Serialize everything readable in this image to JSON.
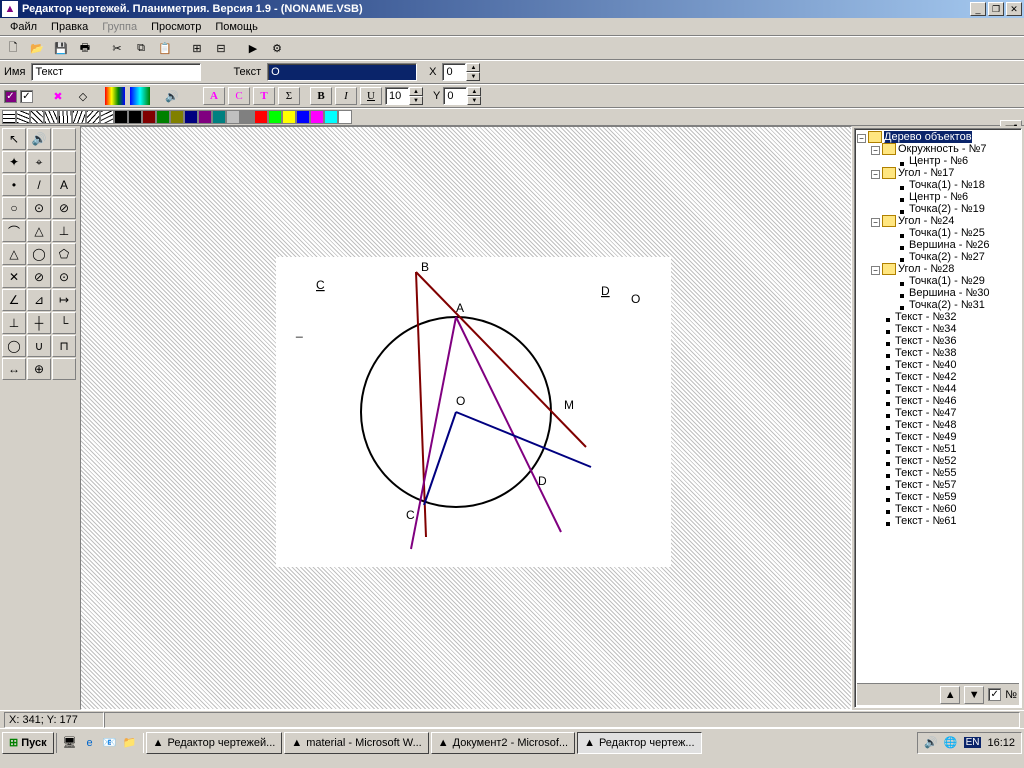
{
  "window": {
    "title": "Редактор чертежей. Планиметрия. Версия 1.9 - (NONAME.VSB)"
  },
  "menu": {
    "file": "Файл",
    "edit": "Правка",
    "group": "Группа",
    "view": "Просмотр",
    "help": "Помощь"
  },
  "props": {
    "name_label": "Имя",
    "name_value": "Текст",
    "text_label": "Текст",
    "text_value": "O",
    "x_label": "X",
    "x_value": "0",
    "y_label": "Y",
    "y_value": "0",
    "fontsize": "10",
    "btn_A": "A",
    "btn_C": "C",
    "btn_T": "T",
    "btn_sigma": "Σ",
    "btn_B": "B",
    "btn_I": "I",
    "btn_U": "U"
  },
  "palette": [
    "#000000",
    "#800000",
    "#008000",
    "#808000",
    "#000080",
    "#800080",
    "#008080",
    "#c0c0c0",
    "#808080",
    "#ff0000",
    "#00ff00",
    "#ffff00",
    "#0000ff",
    "#ff00ff",
    "#00ffff",
    "#ffffff"
  ],
  "tree": {
    "root": "Дерево объектов",
    "nodes": [
      {
        "type": "folder",
        "label": "Окружность - №7",
        "children": [
          {
            "type": "leaf",
            "label": "Центр - №6"
          }
        ]
      },
      {
        "type": "folder",
        "label": "Угол - №17",
        "children": [
          {
            "type": "leaf",
            "label": "Точка(1) - №18"
          },
          {
            "type": "leaf",
            "label": "Центр - №6"
          },
          {
            "type": "leaf",
            "label": "Точка(2) - №19"
          }
        ]
      },
      {
        "type": "folder",
        "label": "Угол - №24",
        "children": [
          {
            "type": "leaf",
            "label": "Точка(1) - №25"
          },
          {
            "type": "leaf",
            "label": "Вершина - №26"
          },
          {
            "type": "leaf",
            "label": "Точка(2) - №27"
          }
        ]
      },
      {
        "type": "folder",
        "label": "Угол - №28",
        "children": [
          {
            "type": "leaf",
            "label": "Точка(1) - №29"
          },
          {
            "type": "leaf",
            "label": "Вершина - №30"
          },
          {
            "type": "leaf",
            "label": "Точка(2) - №31"
          }
        ]
      },
      {
        "type": "leaf",
        "label": "Текст - №32"
      },
      {
        "type": "leaf",
        "label": "Текст - №34"
      },
      {
        "type": "leaf",
        "label": "Текст - №36"
      },
      {
        "type": "leaf",
        "label": "Текст - №38"
      },
      {
        "type": "leaf",
        "label": "Текст - №40"
      },
      {
        "type": "leaf",
        "label": "Текст - №42"
      },
      {
        "type": "leaf",
        "label": "Текст - №44"
      },
      {
        "type": "leaf",
        "label": "Текст - №46"
      },
      {
        "type": "leaf",
        "label": "Текст - №47"
      },
      {
        "type": "leaf",
        "label": "Текст - №48"
      },
      {
        "type": "leaf",
        "label": "Текст - №49"
      },
      {
        "type": "leaf",
        "label": "Текст - №51"
      },
      {
        "type": "leaf",
        "label": "Текст - №52"
      },
      {
        "type": "leaf",
        "label": "Текст - №55"
      },
      {
        "type": "leaf",
        "label": "Текст - №57"
      },
      {
        "type": "leaf",
        "label": "Текст - №59"
      },
      {
        "type": "leaf",
        "label": "Текст - №60"
      },
      {
        "type": "leaf",
        "label": "Текст - №61"
      }
    ],
    "footer_label": "№"
  },
  "status": {
    "coords": "X: 341; Y: 177"
  },
  "taskbar": {
    "start": "Пуск",
    "tasks": [
      "Редактор чертежей...",
      "material - Microsoft W...",
      "Документ2 - Microsof...",
      "Редактор чертеж..."
    ],
    "lang": "EN",
    "clock": "16:12"
  },
  "drawing": {
    "labels": {
      "A": "A",
      "B": "B",
      "C": "C",
      "D": "D",
      "M": "M",
      "O": "O",
      "C2": "C",
      "D2": "D",
      "O2": "O"
    }
  }
}
